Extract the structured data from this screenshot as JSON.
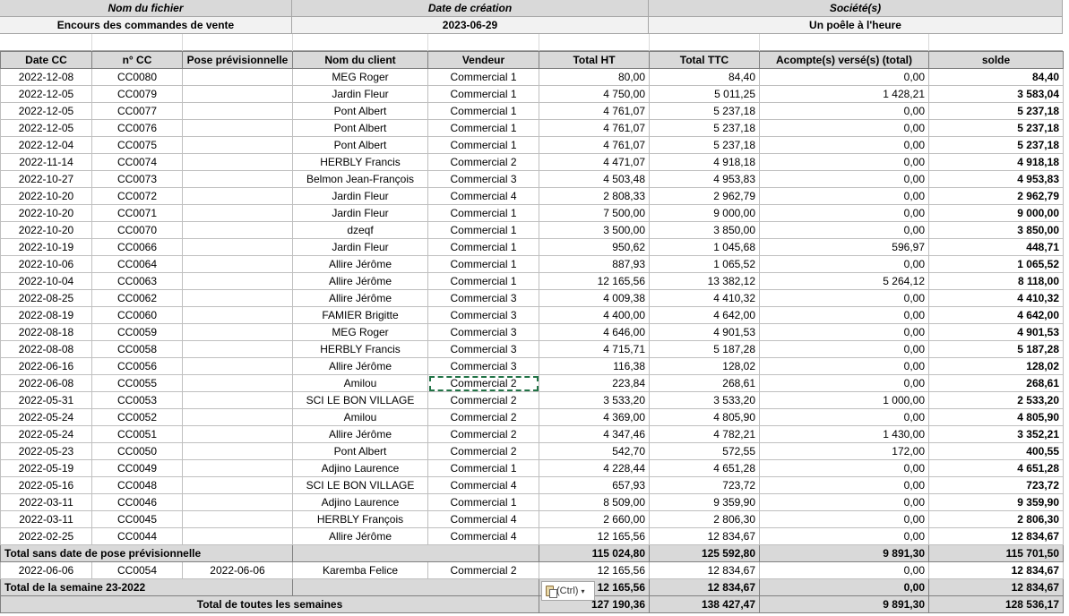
{
  "header": {
    "file_label": "Nom du fichier",
    "file_value": "Encours des commandes de vente",
    "date_label": "Date de création",
    "date_value": "2023-06-29",
    "company_label": "Société(s)",
    "company_value": "Un poêle à l'heure"
  },
  "columns": [
    "Date CC",
    "n° CC",
    "Pose prévisionnelle",
    "Nom du client",
    "Vendeur",
    "Total HT",
    "Total TTC",
    "Acompte(s) versé(s) (total)",
    "solde"
  ],
  "rows": [
    [
      "2022-12-08",
      "CC0080",
      "",
      "MEG Roger",
      "Commercial 1",
      "80,00",
      "84,40",
      "0,00",
      "84,40"
    ],
    [
      "2022-12-05",
      "CC0079",
      "",
      "Jardin Fleur",
      "Commercial 1",
      "4 750,00",
      "5 011,25",
      "1 428,21",
      "3 583,04"
    ],
    [
      "2022-12-05",
      "CC0077",
      "",
      "Pont Albert",
      "Commercial 1",
      "4 761,07",
      "5 237,18",
      "0,00",
      "5 237,18"
    ],
    [
      "2022-12-05",
      "CC0076",
      "",
      "Pont Albert",
      "Commercial 1",
      "4 761,07",
      "5 237,18",
      "0,00",
      "5 237,18"
    ],
    [
      "2022-12-04",
      "CC0075",
      "",
      "Pont Albert",
      "Commercial 1",
      "4 761,07",
      "5 237,18",
      "0,00",
      "5 237,18"
    ],
    [
      "2022-11-14",
      "CC0074",
      "",
      "HERBLY Francis",
      "Commercial 2",
      "4 471,07",
      "4 918,18",
      "0,00",
      "4 918,18"
    ],
    [
      "2022-10-27",
      "CC0073",
      "",
      "Belmon Jean-François",
      "Commercial 3",
      "4 503,48",
      "4 953,83",
      "0,00",
      "4 953,83"
    ],
    [
      "2022-10-20",
      "CC0072",
      "",
      "Jardin Fleur",
      "Commercial 4",
      "2 808,33",
      "2 962,79",
      "0,00",
      "2 962,79"
    ],
    [
      "2022-10-20",
      "CC0071",
      "",
      "Jardin Fleur",
      "Commercial 1",
      "7 500,00",
      "9 000,00",
      "0,00",
      "9 000,00"
    ],
    [
      "2022-10-20",
      "CC0070",
      "",
      "dzeqf",
      "Commercial 1",
      "3 500,00",
      "3 850,00",
      "0,00",
      "3 850,00"
    ],
    [
      "2022-10-19",
      "CC0066",
      "",
      "Jardin Fleur",
      "Commercial 1",
      "950,62",
      "1 045,68",
      "596,97",
      "448,71"
    ],
    [
      "2022-10-06",
      "CC0064",
      "",
      "Allire Jérôme",
      "Commercial 1",
      "887,93",
      "1 065,52",
      "0,00",
      "1 065,52"
    ],
    [
      "2022-10-04",
      "CC0063",
      "",
      "Allire Jérôme",
      "Commercial 1",
      "12 165,56",
      "13 382,12",
      "5 264,12",
      "8 118,00"
    ],
    [
      "2022-08-25",
      "CC0062",
      "",
      "Allire Jérôme",
      "Commercial 3",
      "4 009,38",
      "4 410,32",
      "0,00",
      "4 410,32"
    ],
    [
      "2022-08-19",
      "CC0060",
      "",
      "FAMIER Brigitte",
      "Commercial 3",
      "4 400,00",
      "4 642,00",
      "0,00",
      "4 642,00"
    ],
    [
      "2022-08-18",
      "CC0059",
      "",
      "MEG Roger",
      "Commercial 3",
      "4 646,00",
      "4 901,53",
      "0,00",
      "4 901,53"
    ],
    [
      "2022-08-08",
      "CC0058",
      "",
      "HERBLY Francis",
      "Commercial 3",
      "4 715,71",
      "5 187,28",
      "0,00",
      "5 187,28"
    ],
    [
      "2022-06-16",
      "CC0056",
      "",
      "Allire Jérôme",
      "Commercial 3",
      "116,38",
      "128,02",
      "0,00",
      "128,02"
    ],
    [
      "2022-06-08",
      "CC0055",
      "",
      "Amilou",
      "Commercial 2",
      "223,84",
      "268,61",
      "0,00",
      "268,61"
    ],
    [
      "2022-05-31",
      "CC0053",
      "",
      "SCI LE BON VILLAGE",
      "Commercial 2",
      "3 533,20",
      "3 533,20",
      "1 000,00",
      "2 533,20"
    ],
    [
      "2022-05-24",
      "CC0052",
      "",
      "Amilou",
      "Commercial 2",
      "4 369,00",
      "4 805,90",
      "0,00",
      "4 805,90"
    ],
    [
      "2022-05-24",
      "CC0051",
      "",
      "Allire Jérôme",
      "Commercial 2",
      "4 347,46",
      "4 782,21",
      "1 430,00",
      "3 352,21"
    ],
    [
      "2022-05-23",
      "CC0050",
      "",
      "Pont Albert",
      "Commercial 2",
      "542,70",
      "572,55",
      "172,00",
      "400,55"
    ],
    [
      "2022-05-19",
      "CC0049",
      "",
      "Adjino Laurence",
      "Commercial 1",
      "4 228,44",
      "4 651,28",
      "0,00",
      "4 651,28"
    ],
    [
      "2022-05-16",
      "CC0048",
      "",
      "SCI LE BON VILLAGE",
      "Commercial 4",
      "657,93",
      "723,72",
      "0,00",
      "723,72"
    ],
    [
      "2022-03-11",
      "CC0046",
      "",
      "Adjino Laurence",
      "Commercial 1",
      "8 509,00",
      "9 359,90",
      "0,00",
      "9 359,90"
    ],
    [
      "2022-03-11",
      "CC0045",
      "",
      "HERBLY François",
      "Commercial 4",
      "2 660,00",
      "2 806,30",
      "0,00",
      "2 806,30"
    ],
    [
      "2022-02-25",
      "CC0044",
      "",
      "Allire Jérôme",
      "Commercial 4",
      "12 165,56",
      "12 834,67",
      "0,00",
      "12 834,67"
    ]
  ],
  "total_no_date": {
    "label": "Total sans date de pose prévisionnelle",
    "ht": "115 024,80",
    "ttc": "125 592,80",
    "acompte": "9 891,30",
    "solde": "115 701,50"
  },
  "row_dated": [
    "2022-06-06",
    "CC0054",
    "2022-06-06",
    "Karemba Felice",
    "Commercial 2",
    "12 165,56",
    "12 834,67",
    "0,00",
    "12 834,67"
  ],
  "total_week": {
    "label": "Total de la semaine 23-2022",
    "ht": "12 165,56",
    "ttc": "12 834,67",
    "acompte": "0,00",
    "solde": "12 834,67"
  },
  "total_all": {
    "label": "Total de toutes les semaines",
    "ht": "127 190,36",
    "ttc": "138 427,47",
    "acompte": "9 891,30",
    "solde": "128 536,17"
  },
  "paste_options": {
    "label": "(Ctrl)"
  }
}
